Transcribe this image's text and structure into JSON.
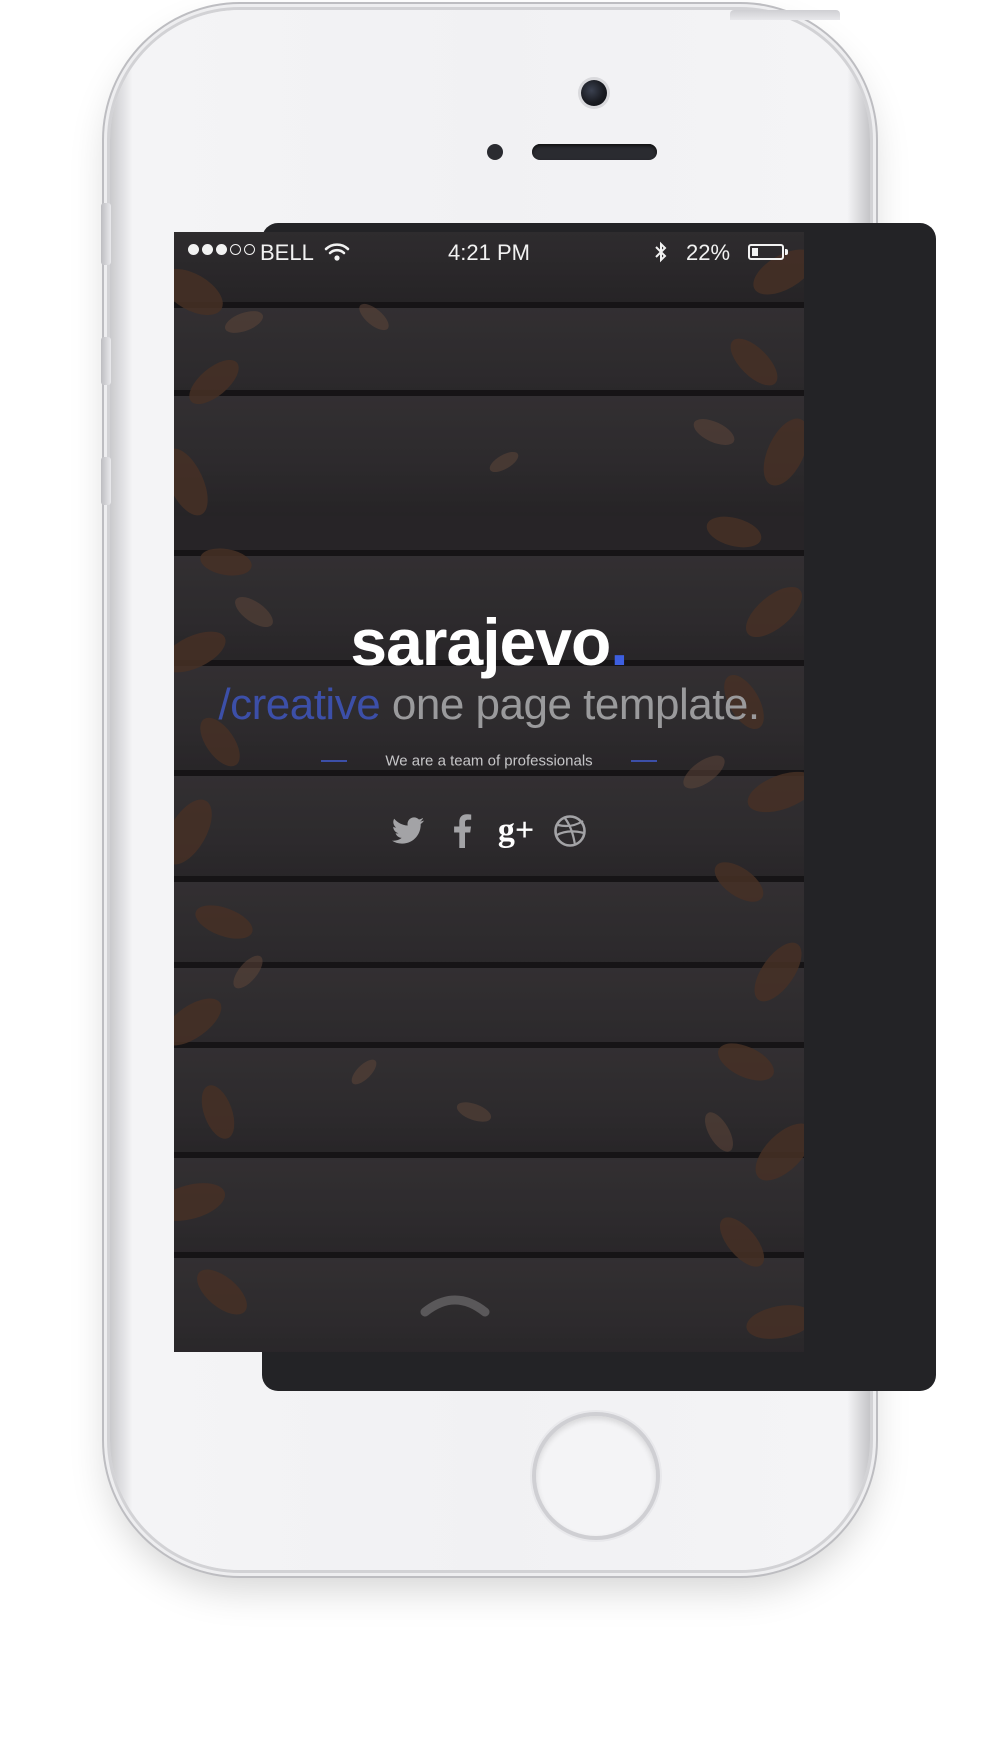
{
  "status_bar": {
    "carrier": "BELL",
    "time": "4:21 PM",
    "battery_percent": "22%",
    "battery_level": 0.22,
    "signal_bars_filled": 3,
    "signal_bars_total": 5
  },
  "hero": {
    "brand_name": "sarajevo",
    "brand_dot": ".",
    "tagline_accent": "/creative",
    "tagline_rest": " one page template.",
    "subtitle": "We are a team of professionals"
  },
  "social": {
    "items": [
      {
        "name": "twitter-icon"
      },
      {
        "name": "facebook-icon"
      },
      {
        "name": "google-plus-icon",
        "label": "g+"
      },
      {
        "name": "dribbble-icon"
      }
    ]
  },
  "colors": {
    "accent": "#3d5fe0",
    "tagline_accent": "#3c4fa8",
    "phone_body": "#f1f1f3"
  }
}
